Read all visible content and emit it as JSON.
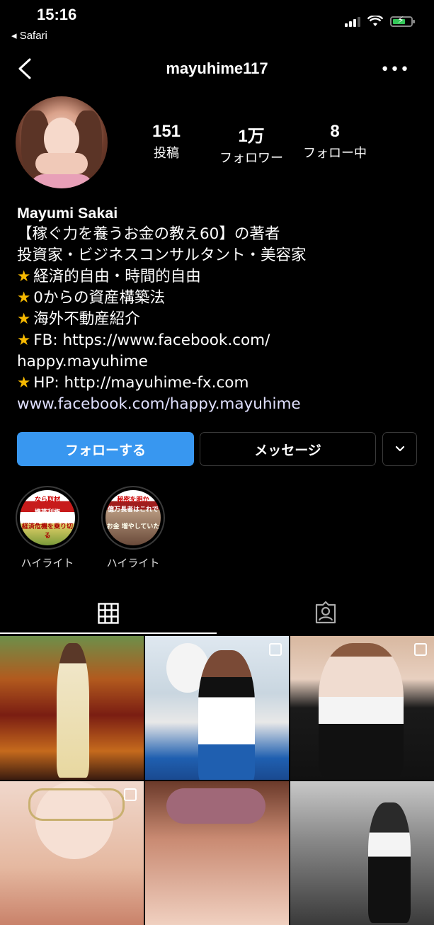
{
  "status_bar": {
    "time": "15:16",
    "back_app": "◂ Safari"
  },
  "header": {
    "username": "mayuhime117",
    "more_label": "•••"
  },
  "stats": [
    {
      "num": "151",
      "label": "投稿"
    },
    {
      "num": "1万",
      "label": "フォロワー"
    },
    {
      "num": "8",
      "label": "フォロー中"
    }
  ],
  "bio": {
    "name": "Mayumi Sakai",
    "lines": [
      "【稼ぐ力を養うお金の教え60】の著者",
      "投資家・ビジネスコンサルタント・美容家",
      "経済的自由・時間的自由",
      "0からの資産構築法",
      "海外不動産紹介",
      "FB: https://www.facebook.com/",
      "happy.mayuhime",
      "HP: http://mayuhime-fx.com",
      "www.facebook.com/happy.mayuhime"
    ]
  },
  "buttons": {
    "follow": "フォローする",
    "message": "メッセージ"
  },
  "highlights": [
    {
      "label": "ハイライト",
      "thumb_text_top": "なら取材",
      "thumb_text_mid": "携帯利権",
      "thumb_text_low": "経済危機を乗り切る"
    },
    {
      "label": "ハイライト",
      "thumb_text_top": "秘密を明か",
      "thumb_text_mid": "億万長者はこれで",
      "thumb_text_low": "お金 増やしていた"
    }
  ],
  "colors": {
    "follow_button": "#3897f0",
    "star": "#f5b800",
    "background": "#000000"
  },
  "icons": [
    "back-chevron-icon",
    "more-icon",
    "grid-icon",
    "tagged-icon",
    "signal-icon",
    "wifi-icon",
    "battery-icon",
    "chevron-down-icon"
  ]
}
